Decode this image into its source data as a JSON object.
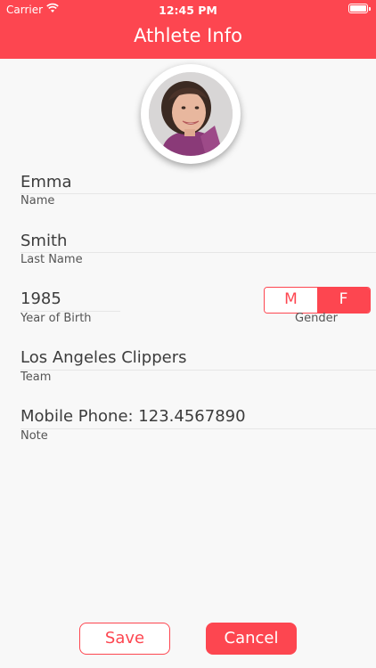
{
  "status_bar": {
    "carrier": "Carrier",
    "time": "12:45 PM",
    "icons": [
      "wifi-icon",
      "battery-icon"
    ]
  },
  "nav": {
    "title": "Athlete Info",
    "color": "#fd4650"
  },
  "profile": {
    "avatar_icon": "avatar-photo"
  },
  "fields": {
    "first_name": {
      "value": "Emma",
      "label": "Name"
    },
    "last_name": {
      "value": "Smith",
      "label": "Last Name"
    },
    "year_of_birth": {
      "value": "1985",
      "label": "Year of Birth"
    },
    "team": {
      "value": "Los Angeles Clippers",
      "label": "Team"
    },
    "note": {
      "value": "Mobile Phone: 123.4567890",
      "label": "Note"
    }
  },
  "gender": {
    "label": "Gender",
    "options": [
      "M",
      "F"
    ],
    "selected": "F"
  },
  "actions": {
    "save_label": "Save",
    "cancel_label": "Cancel"
  },
  "colors": {
    "accent": "#fd4650",
    "background": "#f8f8f8"
  }
}
